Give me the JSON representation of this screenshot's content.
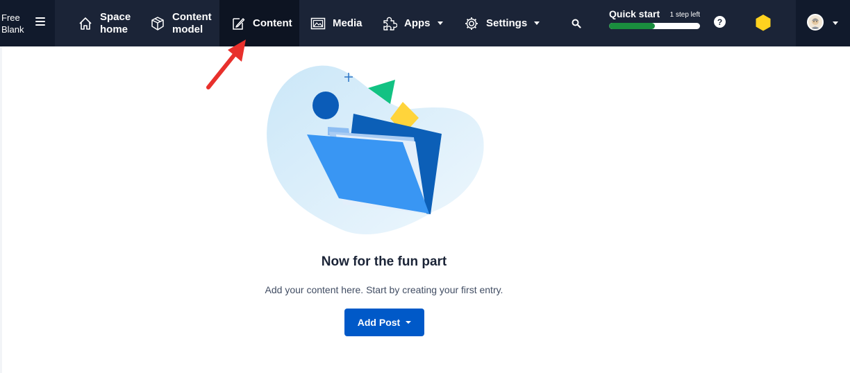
{
  "space": {
    "name": "Free Blank"
  },
  "nav": {
    "space_home": "Space home",
    "content_model": "Content model",
    "content": "Content",
    "media": "Media",
    "apps": "Apps",
    "settings": "Settings"
  },
  "quick_start": {
    "title": "Quick start",
    "steps_left": "1 step left",
    "progress": 0.5
  },
  "help": {
    "label": "?"
  },
  "empty_state": {
    "title": "Now for the fun part",
    "description": "Add your content here. Start by creating your first entry.",
    "add_button": "Add Post"
  },
  "colors": {
    "nav_bg": "#1b2437",
    "nav_active_bg": "#0d1422",
    "primary_button": "#0059c8",
    "progress": "#1a8e3e",
    "annotation_arrow": "#e8302c"
  },
  "icons": [
    "menu-icon",
    "home-icon",
    "content-model-icon",
    "content-icon",
    "media-icon",
    "apps-icon",
    "settings-icon",
    "search-icon",
    "help-icon",
    "org-icon",
    "avatar",
    "chevron-down-icon"
  ]
}
